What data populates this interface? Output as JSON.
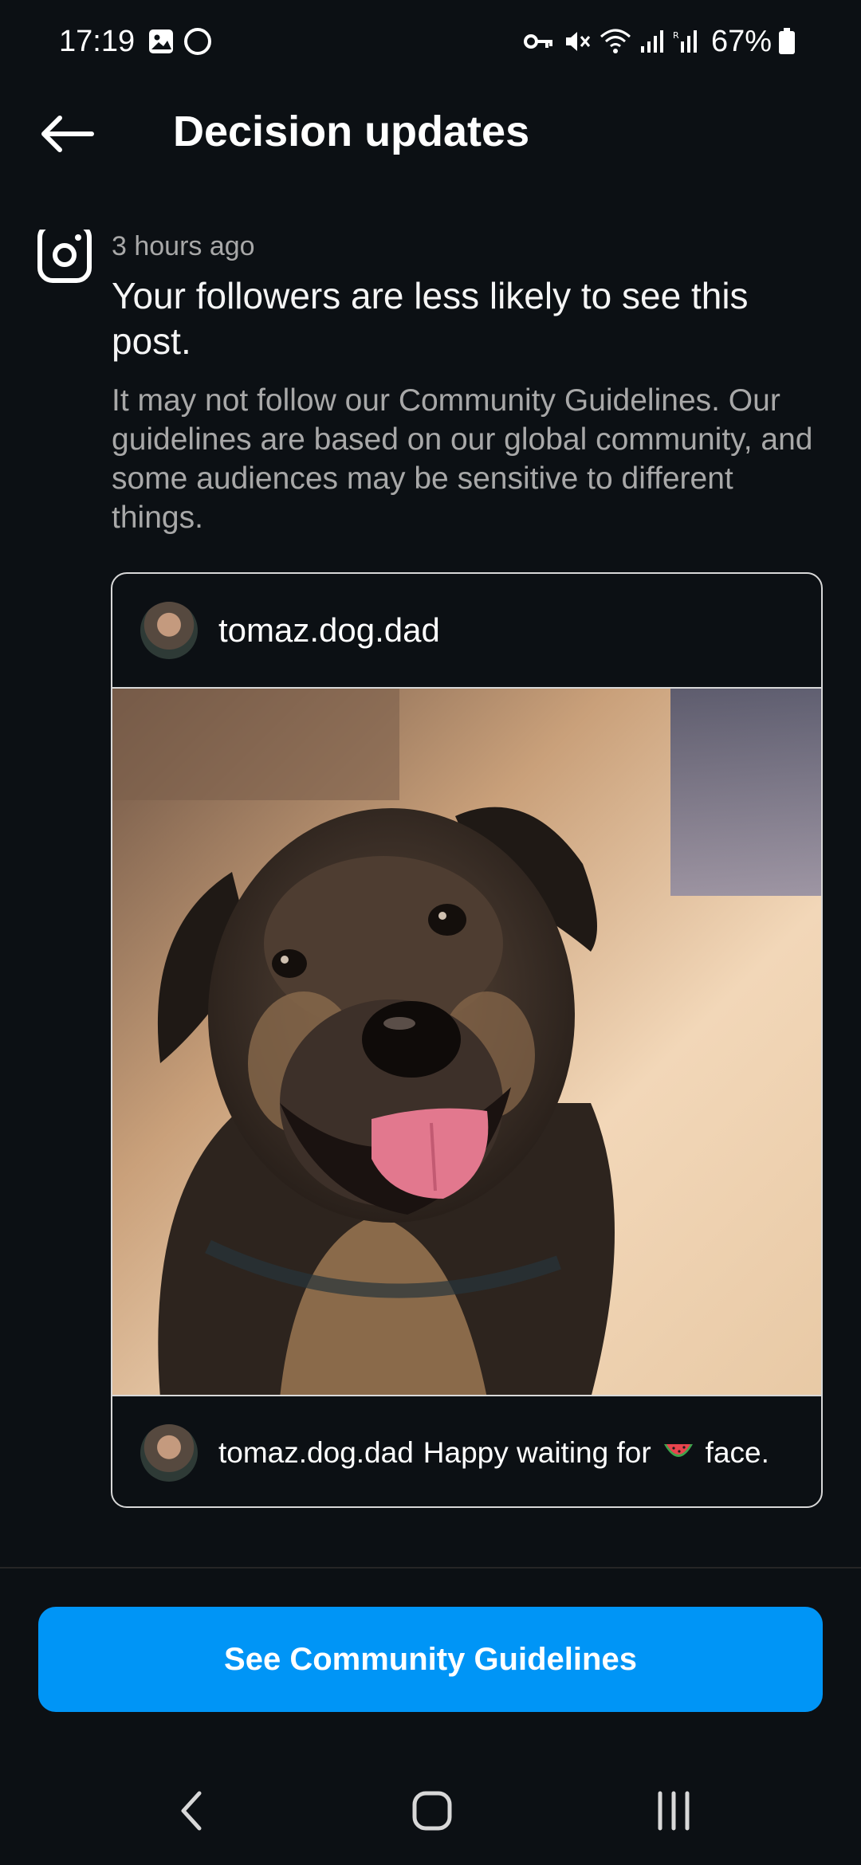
{
  "status_bar": {
    "time": "17:19",
    "battery": "67%",
    "icons": [
      "image-icon",
      "circle-icon",
      "key-icon",
      "mute-icon",
      "wifi-icon",
      "signal-icon",
      "signal-r-icon",
      "battery-icon"
    ]
  },
  "header": {
    "title": "Decision updates",
    "back_icon": "arrow-left-icon"
  },
  "notification": {
    "icon": "instagram-icon",
    "time": "3 hours ago",
    "headline": "Your followers are less likely to see this post.",
    "body": "It may not follow our Community Guidelines. Our guidelines are based on our global community, and some audiences may be sensitive to different things."
  },
  "post": {
    "username": "tomaz.dog.dad",
    "image_subject": "dog-photo",
    "caption_user": "tomaz.dog.dad",
    "caption_before": "Happy waiting for",
    "caption_emoji": "watermelon-emoji",
    "caption_after": "face."
  },
  "cta": {
    "label": "See Community Guidelines"
  },
  "nav": {
    "icons": [
      "back-nav-icon",
      "home-nav-icon",
      "recents-nav-icon"
    ]
  },
  "colors": {
    "background": "#0c1014",
    "accent": "#0095f6",
    "secondary_text": "#a8a8a8"
  }
}
